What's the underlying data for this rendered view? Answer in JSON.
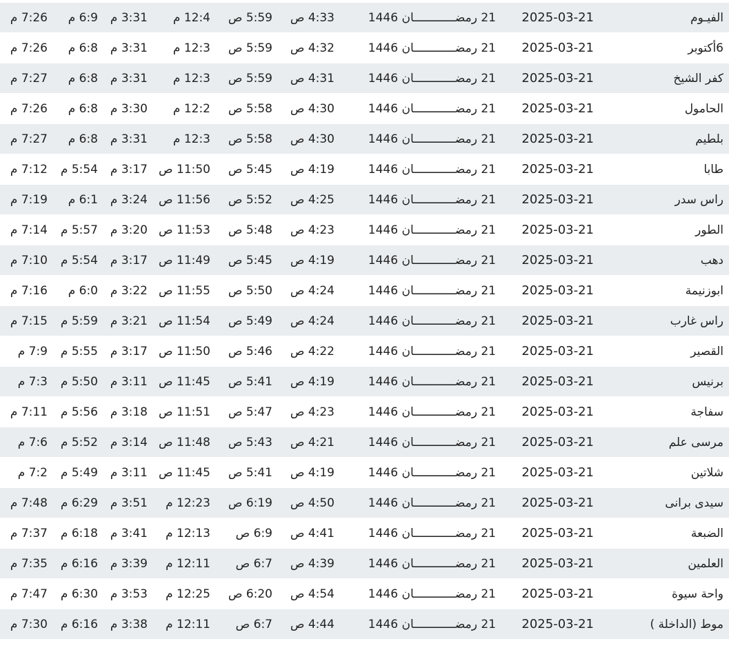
{
  "rows": [
    {
      "city": "الفيـوم",
      "date": "2025-03-21",
      "hijri": "21 رمضــــــــــــان 1446",
      "fajr": "4:33 ص",
      "sunrise": "5:59 ص",
      "dhuhr": "12:4 م",
      "asr": "3:31 م",
      "maghrib": "6:9 م",
      "isha": "7:26 م"
    },
    {
      "city": "6أكتوبر",
      "date": "2025-03-21",
      "hijri": "21 رمضــــــــــــان 1446",
      "fajr": "4:32 ص",
      "sunrise": "5:59 ص",
      "dhuhr": "12:3 م",
      "asr": "3:31 م",
      "maghrib": "6:8 م",
      "isha": "7:26 م"
    },
    {
      "city": "كفر الشيخ",
      "date": "2025-03-21",
      "hijri": "21 رمضــــــــــــان 1446",
      "fajr": "4:31 ص",
      "sunrise": "5:59 ص",
      "dhuhr": "12:3 م",
      "asr": "3:31 م",
      "maghrib": "6:8 م",
      "isha": "7:27 م"
    },
    {
      "city": "الحامول",
      "date": "2025-03-21",
      "hijri": "21 رمضــــــــــــان 1446",
      "fajr": "4:30 ص",
      "sunrise": "5:58 ص",
      "dhuhr": "12:2 م",
      "asr": "3:30 م",
      "maghrib": "6:8 م",
      "isha": "7:26 م"
    },
    {
      "city": "بلطيم",
      "date": "2025-03-21",
      "hijri": "21 رمضــــــــــــان 1446",
      "fajr": "4:30 ص",
      "sunrise": "5:58 ص",
      "dhuhr": "12:3 م",
      "asr": "3:31 م",
      "maghrib": "6:8 م",
      "isha": "7:27 م"
    },
    {
      "city": "طابا",
      "date": "2025-03-21",
      "hijri": "21 رمضــــــــــــان 1446",
      "fajr": "4:19 ص",
      "sunrise": "5:45 ص",
      "dhuhr": "11:50 ص",
      "asr": "3:17 م",
      "maghrib": "5:54 م",
      "isha": "7:12 م"
    },
    {
      "city": "راس سدر",
      "date": "2025-03-21",
      "hijri": "21 رمضــــــــــــان 1446",
      "fajr": "4:25 ص",
      "sunrise": "5:52 ص",
      "dhuhr": "11:56 ص",
      "asr": "3:24 م",
      "maghrib": "6:1 م",
      "isha": "7:19 م"
    },
    {
      "city": "الطور",
      "date": "2025-03-21",
      "hijri": "21 رمضــــــــــــان 1446",
      "fajr": "4:23 ص",
      "sunrise": "5:48 ص",
      "dhuhr": "11:53 ص",
      "asr": "3:20 م",
      "maghrib": "5:57 م",
      "isha": "7:14 م"
    },
    {
      "city": "دهب",
      "date": "2025-03-21",
      "hijri": "21 رمضــــــــــــان 1446",
      "fajr": "4:19 ص",
      "sunrise": "5:45 ص",
      "dhuhr": "11:49 ص",
      "asr": "3:17 م",
      "maghrib": "5:54 م",
      "isha": "7:10 م"
    },
    {
      "city": "ابوزنيمة",
      "date": "2025-03-21",
      "hijri": "21 رمضــــــــــــان 1446",
      "fajr": "4:24 ص",
      "sunrise": "5:50 ص",
      "dhuhr": "11:55 ص",
      "asr": "3:22 م",
      "maghrib": "6:0 م",
      "isha": "7:16 م"
    },
    {
      "city": "راس غارب",
      "date": "2025-03-21",
      "hijri": "21 رمضــــــــــــان 1446",
      "fajr": "4:24 ص",
      "sunrise": "5:49 ص",
      "dhuhr": "11:54 ص",
      "asr": "3:21 م",
      "maghrib": "5:59 م",
      "isha": "7:15 م"
    },
    {
      "city": "القصير",
      "date": "2025-03-21",
      "hijri": "21 رمضــــــــــــان 1446",
      "fajr": "4:22 ص",
      "sunrise": "5:46 ص",
      "dhuhr": "11:50 ص",
      "asr": "3:17 م",
      "maghrib": "5:55 م",
      "isha": "7:9 م"
    },
    {
      "city": "برنيس",
      "date": "2025-03-21",
      "hijri": "21 رمضــــــــــــان 1446",
      "fajr": "4:19 ص",
      "sunrise": "5:41 ص",
      "dhuhr": "11:45 ص",
      "asr": "3:11 م",
      "maghrib": "5:50 م",
      "isha": "7:3 م"
    },
    {
      "city": "سفاجة",
      "date": "2025-03-21",
      "hijri": "21 رمضــــــــــــان 1446",
      "fajr": "4:23 ص",
      "sunrise": "5:47 ص",
      "dhuhr": "11:51 ص",
      "asr": "3:18 م",
      "maghrib": "5:56 م",
      "isha": "7:11 م"
    },
    {
      "city": "مرسى علم",
      "date": "2025-03-21",
      "hijri": "21 رمضــــــــــــان 1446",
      "fajr": "4:21 ص",
      "sunrise": "5:43 ص",
      "dhuhr": "11:48 ص",
      "asr": "3:14 م",
      "maghrib": "5:52 م",
      "isha": "7:6 م"
    },
    {
      "city": "شلاتين",
      "date": "2025-03-21",
      "hijri": "21 رمضــــــــــــان 1446",
      "fajr": "4:19 ص",
      "sunrise": "5:41 ص",
      "dhuhr": "11:45 ص",
      "asr": "3:11 م",
      "maghrib": "5:49 م",
      "isha": "7:2 م"
    },
    {
      "city": "سيدى برانى",
      "date": "2025-03-21",
      "hijri": "21 رمضــــــــــــان 1446",
      "fajr": "4:50 ص",
      "sunrise": "6:19 ص",
      "dhuhr": "12:23 م",
      "asr": "3:51 م",
      "maghrib": "6:29 م",
      "isha": "7:48 م"
    },
    {
      "city": "الضبعة",
      "date": "2025-03-21",
      "hijri": "21 رمضــــــــــــان 1446",
      "fajr": "4:41 ص",
      "sunrise": "6:9 ص",
      "dhuhr": "12:13 م",
      "asr": "3:41 م",
      "maghrib": "6:18 م",
      "isha": "7:37 م"
    },
    {
      "city": "العلمين",
      "date": "2025-03-21",
      "hijri": "21 رمضــــــــــــان 1446",
      "fajr": "4:39 ص",
      "sunrise": "6:7 ص",
      "dhuhr": "12:11 م",
      "asr": "3:39 م",
      "maghrib": "6:16 م",
      "isha": "7:35 م"
    },
    {
      "city": "واحة سيوة",
      "date": "2025-03-21",
      "hijri": "21 رمضــــــــــــان 1446",
      "fajr": "4:54 ص",
      "sunrise": "6:20 ص",
      "dhuhr": "12:25 م",
      "asr": "3:53 م",
      "maghrib": "6:30 م",
      "isha": "7:47 م"
    },
    {
      "city": "موط (الداخلة )",
      "date": "2025-03-21",
      "hijri": "21 رمضــــــــــــان 1446",
      "fajr": "4:44 ص",
      "sunrise": "6:7 ص",
      "dhuhr": "12:11 م",
      "asr": "3:38 م",
      "maghrib": "6:16 م",
      "isha": "7:30 م"
    }
  ]
}
